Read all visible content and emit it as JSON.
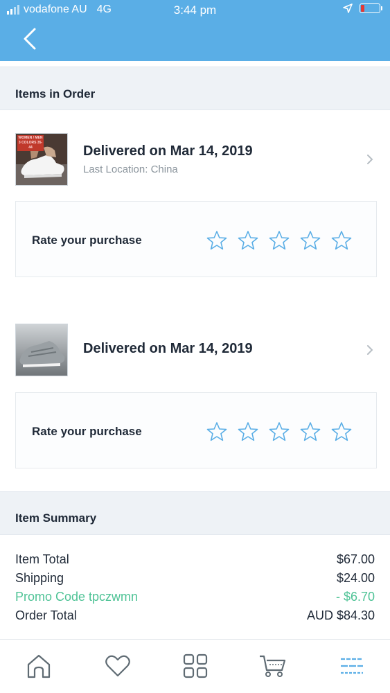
{
  "status_bar": {
    "carrier": "vodafone AU",
    "network": "4G",
    "time": "3:44 pm"
  },
  "header": {
    "back_icon": "chevron-left-icon"
  },
  "sections": {
    "items_title": "Items in Order",
    "summary_title": "Item Summary"
  },
  "items": [
    {
      "status": "Delivered on Mar 14, 2019",
      "location": "Last Location: China",
      "rate_label": "Rate your purchase",
      "rating": 0,
      "thumb_text": "WOMEN / MEN  3 COLORS  35-44"
    },
    {
      "status": "Delivered on Mar 14, 2019",
      "location": "",
      "rate_label": "Rate your purchase",
      "rating": 0
    }
  ],
  "summary": {
    "rows": [
      {
        "label": "Item Total",
        "value": "$67.00"
      },
      {
        "label": "Shipping",
        "value": "$24.00"
      },
      {
        "label": "Promo Code tpczwmn",
        "value": "- $6.70"
      },
      {
        "label": "Order Total",
        "value": "AUD $84.30"
      }
    ]
  },
  "tabbar": {
    "tabs": [
      "home-icon",
      "heart-icon",
      "grid-icon",
      "cart-icon",
      "menu-icon"
    ],
    "active_index": 4
  },
  "colors": {
    "header": "#5aaee6",
    "star": "#5aaee6",
    "promo": "#4fc396",
    "active_tab": "#5aaee6"
  }
}
